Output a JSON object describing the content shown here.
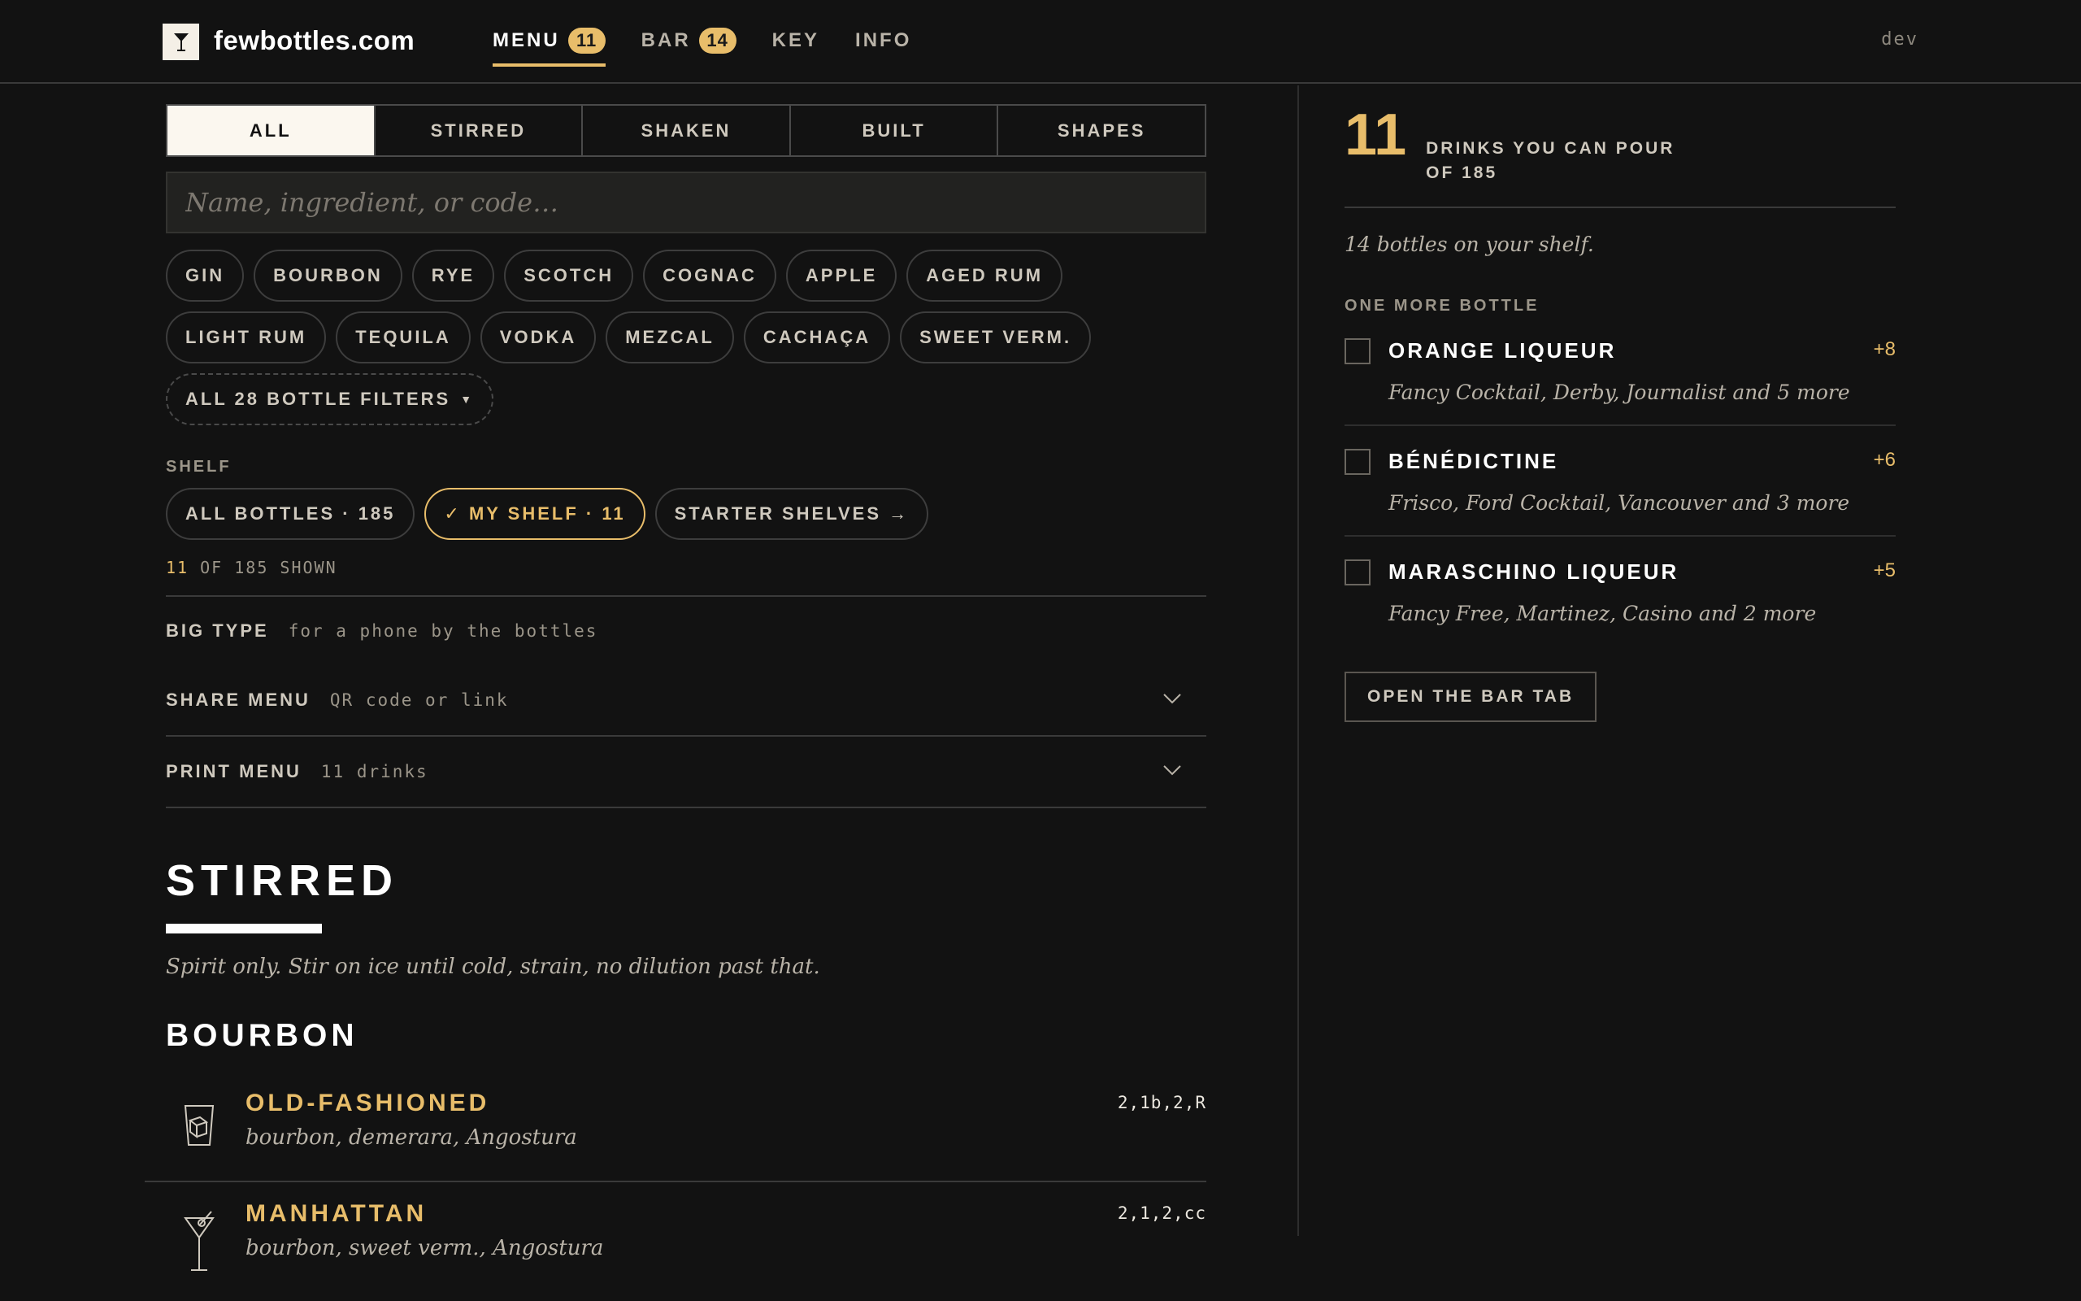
{
  "header": {
    "site_name": "fewbottles.com",
    "nav": [
      {
        "label": "MENU",
        "badge": "11"
      },
      {
        "label": "BAR",
        "badge": "14"
      },
      {
        "label": "KEY"
      },
      {
        "label": "INFO"
      }
    ],
    "env": "dev"
  },
  "tabs": [
    "ALL",
    "STIRRED",
    "SHAKEN",
    "BUILT",
    "SHAPES"
  ],
  "search": {
    "placeholder": "Name, ingredient, or code…",
    "value": ""
  },
  "filters": [
    "GIN",
    "BOURBON",
    "RYE",
    "SCOTCH",
    "COGNAC",
    "APPLE",
    "AGED RUM",
    "LIGHT RUM",
    "TEQUILA",
    "VODKA",
    "MEZCAL",
    "CACHAÇA",
    "SWEET VERM."
  ],
  "all_filters_label": "ALL 28 BOTTLE FILTERS",
  "shelf": {
    "label": "SHELF",
    "options": [
      "ALL BOTTLES · 185",
      "✓ MY SHELF · 11",
      "STARTER SHELVES →"
    ],
    "shown_count": "11",
    "shown_rest": "OF 185 SHOWN"
  },
  "options": {
    "big_type": {
      "title": "BIG TYPE",
      "sub": "for a phone by the bottles"
    },
    "share": {
      "title": "SHARE MENU",
      "sub": "QR code or link"
    },
    "print": {
      "title": "PRINT MENU",
      "sub": "11 drinks"
    }
  },
  "section": {
    "title": "STIRRED",
    "description": "Spirit only. Stir on ice until cold, strain, no dilution past that.",
    "group": "BOURBON",
    "drinks": [
      {
        "name": "OLD-FASHIONED",
        "ingredients": "bourbon, demerara, Angostura",
        "code": "2,1b,2,R",
        "icon": "rocks-glass-icon"
      },
      {
        "name": "MANHATTAN",
        "ingredients": "bourbon, sweet verm., Angostura",
        "code": "2,1,2,cc",
        "icon": "cocktail-glass-icon"
      }
    ]
  },
  "summary": {
    "count": "11",
    "text_line1": "DRINKS YOU CAN POUR",
    "text_line2": "OF 185",
    "bottles": "14 bottles on your shelf."
  },
  "one_more": {
    "label": "ONE MORE BOTTLE",
    "items": [
      {
        "name": "ORANGE LIQUEUR",
        "plus": "+8",
        "drinks": "Fancy Cocktail, Derby, Journalist and 5 more"
      },
      {
        "name": "BÉNÉDICTINE",
        "plus": "+6",
        "drinks": "Frisco, Ford Cocktail, Vancouver and 3 more"
      },
      {
        "name": "MARASCHINO LIQUEUR",
        "plus": "+5",
        "drinks": "Fancy Free, Martinez, Casino and 2 more"
      }
    ],
    "button": "OPEN THE BAR TAB"
  },
  "colors": {
    "accent": "#e8bd6a",
    "background": "#121212"
  }
}
